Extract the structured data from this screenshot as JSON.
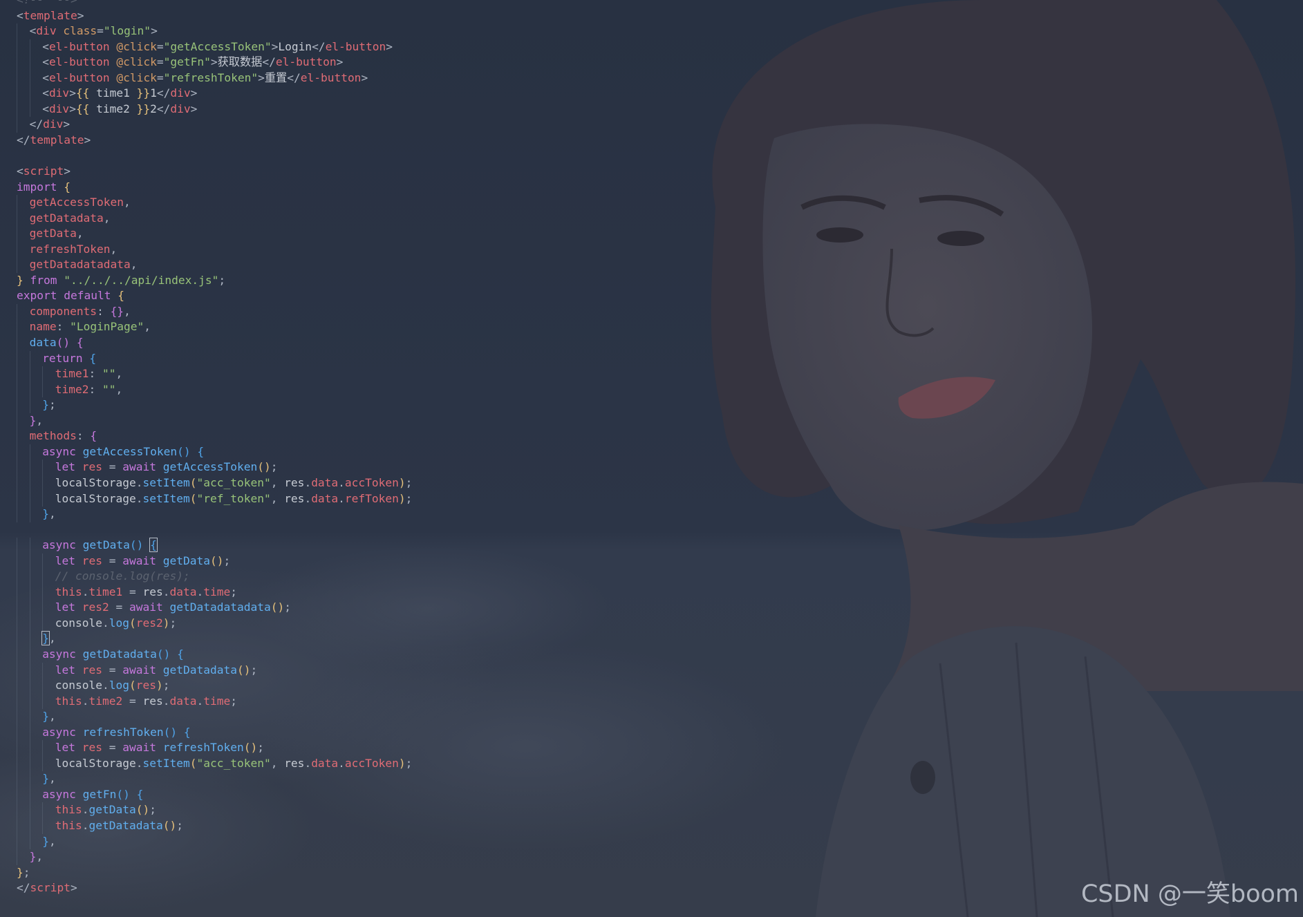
{
  "watermark": "CSDN @一笑boom",
  "background_image": "woman-portrait-over-sky",
  "colors": {
    "editor_background": "#283141",
    "tag": "#e06c75",
    "attribute": "#d19a66",
    "string": "#98c379",
    "keyword": "#c678dd",
    "function": "#61afef",
    "property": "#e06c75",
    "comment": "#5c6370"
  },
  "code_lines": [
    [
      [
        0,
        "com",
        "<!--  -->"
      ]
    ],
    [
      [
        0,
        "punc",
        "<"
      ],
      [
        0,
        "tag",
        "template"
      ],
      [
        0,
        "punc",
        ">"
      ]
    ],
    [
      [
        1,
        "punc",
        "<"
      ],
      [
        1,
        "tag",
        "div"
      ],
      [
        1,
        "attr",
        " class"
      ],
      [
        1,
        "punc",
        "="
      ],
      [
        1,
        "str",
        "\"login\""
      ],
      [
        1,
        "punc",
        ">"
      ]
    ],
    [
      [
        2,
        "punc",
        "<"
      ],
      [
        2,
        "tag",
        "el-button"
      ],
      [
        2,
        "attr",
        " @click"
      ],
      [
        2,
        "punc",
        "="
      ],
      [
        2,
        "str",
        "\"getAccessToken\""
      ],
      [
        2,
        "punc",
        ">"
      ],
      [
        2,
        "text",
        "Login"
      ],
      [
        2,
        "punc",
        "</"
      ],
      [
        2,
        "tag",
        "el-button"
      ],
      [
        2,
        "punc",
        ">"
      ]
    ],
    [
      [
        2,
        "punc",
        "<"
      ],
      [
        2,
        "tag",
        "el-button"
      ],
      [
        2,
        "attr",
        " @click"
      ],
      [
        2,
        "punc",
        "="
      ],
      [
        2,
        "str",
        "\"getFn\""
      ],
      [
        2,
        "punc",
        ">"
      ],
      [
        2,
        "text",
        "获取数据"
      ],
      [
        2,
        "punc",
        "</"
      ],
      [
        2,
        "tag",
        "el-button"
      ],
      [
        2,
        "punc",
        ">"
      ]
    ],
    [
      [
        2,
        "punc",
        "<"
      ],
      [
        2,
        "tag",
        "el-button"
      ],
      [
        2,
        "attr",
        " @click"
      ],
      [
        2,
        "punc",
        "="
      ],
      [
        2,
        "str",
        "\"refreshToken\""
      ],
      [
        2,
        "punc",
        ">"
      ],
      [
        2,
        "text",
        "重置"
      ],
      [
        2,
        "punc",
        "</"
      ],
      [
        2,
        "tag",
        "el-button"
      ],
      [
        2,
        "punc",
        ">"
      ]
    ],
    [
      [
        2,
        "punc",
        "<"
      ],
      [
        2,
        "tag",
        "div"
      ],
      [
        2,
        "punc",
        ">"
      ],
      [
        2,
        "var",
        "{{"
      ],
      [
        2,
        "text",
        " time1 "
      ],
      [
        2,
        "var",
        "}}"
      ],
      [
        2,
        "text",
        "1"
      ],
      [
        2,
        "punc",
        "</"
      ],
      [
        2,
        "tag",
        "div"
      ],
      [
        2,
        "punc",
        ">"
      ]
    ],
    [
      [
        2,
        "punc",
        "<"
      ],
      [
        2,
        "tag",
        "div"
      ],
      [
        2,
        "punc",
        ">"
      ],
      [
        2,
        "var",
        "{{"
      ],
      [
        2,
        "text",
        " time2 "
      ],
      [
        2,
        "var",
        "}}"
      ],
      [
        2,
        "text",
        "2"
      ],
      [
        2,
        "punc",
        "</"
      ],
      [
        2,
        "tag",
        "div"
      ],
      [
        2,
        "punc",
        ">"
      ]
    ],
    [
      [
        1,
        "punc",
        "</"
      ],
      [
        1,
        "tag",
        "div"
      ],
      [
        1,
        "punc",
        ">"
      ]
    ],
    [
      [
        0,
        "punc",
        "</"
      ],
      [
        0,
        "tag",
        "template"
      ],
      [
        0,
        "punc",
        ">"
      ]
    ],
    [],
    [
      [
        0,
        "punc",
        "<"
      ],
      [
        0,
        "tag",
        "script"
      ],
      [
        0,
        "punc",
        ">"
      ]
    ],
    [
      [
        0,
        "kw",
        "import"
      ],
      [
        0,
        "text",
        " "
      ],
      [
        0,
        "b1",
        "{"
      ]
    ],
    [
      [
        1,
        "prop",
        "getAccessToken"
      ],
      [
        1,
        "punc",
        ","
      ]
    ],
    [
      [
        1,
        "prop",
        "getDatadata"
      ],
      [
        1,
        "punc",
        ","
      ]
    ],
    [
      [
        1,
        "prop",
        "getData"
      ],
      [
        1,
        "punc",
        ","
      ]
    ],
    [
      [
        1,
        "prop",
        "refreshToken"
      ],
      [
        1,
        "punc",
        ","
      ]
    ],
    [
      [
        1,
        "prop",
        "getDatadatadata"
      ],
      [
        1,
        "punc",
        ","
      ]
    ],
    [
      [
        0,
        "b1",
        "}"
      ],
      [
        0,
        "kw",
        " from"
      ],
      [
        0,
        "text",
        " "
      ],
      [
        0,
        "str",
        "\"../../../api/index.js\""
      ],
      [
        0,
        "punc",
        ";"
      ]
    ],
    [
      [
        0,
        "kw",
        "export"
      ],
      [
        0,
        "kw",
        " default"
      ],
      [
        0,
        "text",
        " "
      ],
      [
        0,
        "b1",
        "{"
      ]
    ],
    [
      [
        1,
        "prop",
        "components"
      ],
      [
        1,
        "punc",
        ": "
      ],
      [
        1,
        "b2",
        "{}"
      ],
      [
        1,
        "punc",
        ","
      ]
    ],
    [
      [
        1,
        "prop",
        "name"
      ],
      [
        1,
        "punc",
        ": "
      ],
      [
        1,
        "str",
        "\"LoginPage\""
      ],
      [
        1,
        "punc",
        ","
      ]
    ],
    [
      [
        1,
        "fn",
        "data"
      ],
      [
        1,
        "b2",
        "()"
      ],
      [
        1,
        "text",
        " "
      ],
      [
        1,
        "b2",
        "{"
      ]
    ],
    [
      [
        2,
        "kw",
        "return"
      ],
      [
        2,
        "text",
        " "
      ],
      [
        2,
        "b3",
        "{"
      ]
    ],
    [
      [
        3,
        "prop",
        "time1"
      ],
      [
        3,
        "punc",
        ": "
      ],
      [
        3,
        "str",
        "\"\""
      ],
      [
        3,
        "punc",
        ","
      ]
    ],
    [
      [
        3,
        "prop",
        "time2"
      ],
      [
        3,
        "punc",
        ": "
      ],
      [
        3,
        "str",
        "\"\""
      ],
      [
        3,
        "punc",
        ","
      ]
    ],
    [
      [
        2,
        "b3",
        "}"
      ],
      [
        2,
        "punc",
        ";"
      ]
    ],
    [
      [
        1,
        "b2",
        "}"
      ],
      [
        1,
        "punc",
        ","
      ]
    ],
    [
      [
        1,
        "prop",
        "methods"
      ],
      [
        1,
        "punc",
        ": "
      ],
      [
        1,
        "b2",
        "{"
      ]
    ],
    [
      [
        2,
        "kw",
        "async"
      ],
      [
        2,
        "fn",
        " getAccessToken"
      ],
      [
        2,
        "b3",
        "()"
      ],
      [
        2,
        "text",
        " "
      ],
      [
        2,
        "b3",
        "{"
      ]
    ],
    [
      [
        3,
        "kw",
        "let"
      ],
      [
        3,
        "prop",
        " res"
      ],
      [
        3,
        "punc",
        " = "
      ],
      [
        3,
        "kw",
        "await"
      ],
      [
        3,
        "fn",
        " getAccessToken"
      ],
      [
        3,
        "b1",
        "()"
      ],
      [
        3,
        "punc",
        ";"
      ]
    ],
    [
      [
        3,
        "text",
        "localStorage"
      ],
      [
        3,
        "punc",
        "."
      ],
      [
        3,
        "fn",
        "setItem"
      ],
      [
        3,
        "b1",
        "("
      ],
      [
        3,
        "str",
        "\"acc_token\""
      ],
      [
        3,
        "punc",
        ", "
      ],
      [
        3,
        "text",
        "res"
      ],
      [
        3,
        "punc",
        "."
      ],
      [
        3,
        "prop",
        "data"
      ],
      [
        3,
        "punc",
        "."
      ],
      [
        3,
        "prop",
        "accToken"
      ],
      [
        3,
        "b1",
        ")"
      ],
      [
        3,
        "punc",
        ";"
      ]
    ],
    [
      [
        3,
        "text",
        "localStorage"
      ],
      [
        3,
        "punc",
        "."
      ],
      [
        3,
        "fn",
        "setItem"
      ],
      [
        3,
        "b1",
        "("
      ],
      [
        3,
        "str",
        "\"ref_token\""
      ],
      [
        3,
        "punc",
        ", "
      ],
      [
        3,
        "text",
        "res"
      ],
      [
        3,
        "punc",
        "."
      ],
      [
        3,
        "prop",
        "data"
      ],
      [
        3,
        "punc",
        "."
      ],
      [
        3,
        "prop",
        "refToken"
      ],
      [
        3,
        "b1",
        ")"
      ],
      [
        3,
        "punc",
        ";"
      ]
    ],
    [
      [
        2,
        "b3",
        "}"
      ],
      [
        2,
        "punc",
        ","
      ]
    ],
    [],
    [
      [
        2,
        "kw",
        "async"
      ],
      [
        2,
        "fn",
        " getData"
      ],
      [
        2,
        "b3",
        "()"
      ],
      [
        2,
        "text",
        " "
      ],
      [
        2,
        "b3",
        "{",
        "cursor"
      ]
    ],
    [
      [
        3,
        "kw",
        "let"
      ],
      [
        3,
        "prop",
        " res"
      ],
      [
        3,
        "punc",
        " = "
      ],
      [
        3,
        "kw",
        "await"
      ],
      [
        3,
        "fn",
        " getData"
      ],
      [
        3,
        "b1",
        "()"
      ],
      [
        3,
        "punc",
        ";"
      ]
    ],
    [
      [
        3,
        "com",
        "// console.log(res);"
      ]
    ],
    [
      [
        3,
        "prop",
        "this"
      ],
      [
        3,
        "punc",
        "."
      ],
      [
        3,
        "prop",
        "time1"
      ],
      [
        3,
        "punc",
        " = "
      ],
      [
        3,
        "text",
        "res"
      ],
      [
        3,
        "punc",
        "."
      ],
      [
        3,
        "prop",
        "data"
      ],
      [
        3,
        "punc",
        "."
      ],
      [
        3,
        "prop",
        "time"
      ],
      [
        3,
        "punc",
        ";"
      ]
    ],
    [
      [
        3,
        "kw",
        "let"
      ],
      [
        3,
        "prop",
        " res2"
      ],
      [
        3,
        "punc",
        " = "
      ],
      [
        3,
        "kw",
        "await"
      ],
      [
        3,
        "fn",
        " getDatadatadata"
      ],
      [
        3,
        "b1",
        "()"
      ],
      [
        3,
        "punc",
        ";"
      ]
    ],
    [
      [
        3,
        "text",
        "console"
      ],
      [
        3,
        "punc",
        "."
      ],
      [
        3,
        "fn",
        "log"
      ],
      [
        3,
        "b1",
        "("
      ],
      [
        3,
        "prop",
        "res2"
      ],
      [
        3,
        "b1",
        ")"
      ],
      [
        3,
        "punc",
        ";"
      ]
    ],
    [
      [
        2,
        "b3",
        "}",
        "cursor"
      ],
      [
        2,
        "punc",
        ","
      ]
    ],
    [
      [
        2,
        "kw",
        "async"
      ],
      [
        2,
        "fn",
        " getDatadata"
      ],
      [
        2,
        "b3",
        "()"
      ],
      [
        2,
        "text",
        " "
      ],
      [
        2,
        "b3",
        "{"
      ]
    ],
    [
      [
        3,
        "kw",
        "let"
      ],
      [
        3,
        "prop",
        " res"
      ],
      [
        3,
        "punc",
        " = "
      ],
      [
        3,
        "kw",
        "await"
      ],
      [
        3,
        "fn",
        " getDatadata"
      ],
      [
        3,
        "b1",
        "()"
      ],
      [
        3,
        "punc",
        ";"
      ]
    ],
    [
      [
        3,
        "text",
        "console"
      ],
      [
        3,
        "punc",
        "."
      ],
      [
        3,
        "fn",
        "log"
      ],
      [
        3,
        "b1",
        "("
      ],
      [
        3,
        "prop",
        "res"
      ],
      [
        3,
        "b1",
        ")"
      ],
      [
        3,
        "punc",
        ";"
      ]
    ],
    [
      [
        3,
        "prop",
        "this"
      ],
      [
        3,
        "punc",
        "."
      ],
      [
        3,
        "prop",
        "time2"
      ],
      [
        3,
        "punc",
        " = "
      ],
      [
        3,
        "text",
        "res"
      ],
      [
        3,
        "punc",
        "."
      ],
      [
        3,
        "prop",
        "data"
      ],
      [
        3,
        "punc",
        "."
      ],
      [
        3,
        "prop",
        "time"
      ],
      [
        3,
        "punc",
        ";"
      ]
    ],
    [
      [
        2,
        "b3",
        "}"
      ],
      [
        2,
        "punc",
        ","
      ]
    ],
    [
      [
        2,
        "kw",
        "async"
      ],
      [
        2,
        "fn",
        " refreshToken"
      ],
      [
        2,
        "b3",
        "()"
      ],
      [
        2,
        "text",
        " "
      ],
      [
        2,
        "b3",
        "{"
      ]
    ],
    [
      [
        3,
        "kw",
        "let"
      ],
      [
        3,
        "prop",
        " res"
      ],
      [
        3,
        "punc",
        " = "
      ],
      [
        3,
        "kw",
        "await"
      ],
      [
        3,
        "fn",
        " refreshToken"
      ],
      [
        3,
        "b1",
        "()"
      ],
      [
        3,
        "punc",
        ";"
      ]
    ],
    [
      [
        3,
        "text",
        "localStorage"
      ],
      [
        3,
        "punc",
        "."
      ],
      [
        3,
        "fn",
        "setItem"
      ],
      [
        3,
        "b1",
        "("
      ],
      [
        3,
        "str",
        "\"acc_token\""
      ],
      [
        3,
        "punc",
        ", "
      ],
      [
        3,
        "text",
        "res"
      ],
      [
        3,
        "punc",
        "."
      ],
      [
        3,
        "prop",
        "data"
      ],
      [
        3,
        "punc",
        "."
      ],
      [
        3,
        "prop",
        "accToken"
      ],
      [
        3,
        "b1",
        ")"
      ],
      [
        3,
        "punc",
        ";"
      ]
    ],
    [
      [
        2,
        "b3",
        "}"
      ],
      [
        2,
        "punc",
        ","
      ]
    ],
    [
      [
        2,
        "kw",
        "async"
      ],
      [
        2,
        "fn",
        " getFn"
      ],
      [
        2,
        "b3",
        "()"
      ],
      [
        2,
        "text",
        " "
      ],
      [
        2,
        "b3",
        "{"
      ]
    ],
    [
      [
        3,
        "prop",
        "this"
      ],
      [
        3,
        "punc",
        "."
      ],
      [
        3,
        "fn",
        "getData"
      ],
      [
        3,
        "b1",
        "()"
      ],
      [
        3,
        "punc",
        ";"
      ]
    ],
    [
      [
        3,
        "prop",
        "this"
      ],
      [
        3,
        "punc",
        "."
      ],
      [
        3,
        "fn",
        "getDatadata"
      ],
      [
        3,
        "b1",
        "()"
      ],
      [
        3,
        "punc",
        ";"
      ]
    ],
    [
      [
        2,
        "b3",
        "}"
      ],
      [
        2,
        "punc",
        ","
      ]
    ],
    [
      [
        1,
        "b2",
        "}"
      ],
      [
        1,
        "punc",
        ","
      ]
    ],
    [
      [
        0,
        "b1",
        "}"
      ],
      [
        0,
        "punc",
        ";"
      ]
    ],
    [
      [
        0,
        "punc",
        "</"
      ],
      [
        0,
        "tag",
        "script"
      ],
      [
        0,
        "punc",
        ">"
      ]
    ]
  ]
}
